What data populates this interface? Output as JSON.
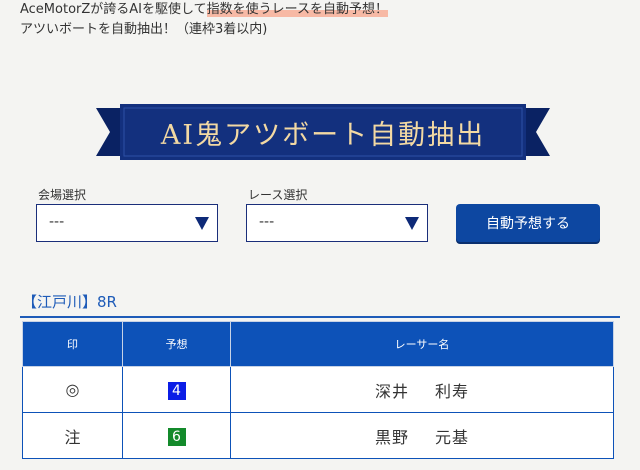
{
  "intro": {
    "line1_pre": "AceMotorZが誇るAIを駆使して",
    "line1_hl": "指数を使うレースを自動予想！",
    "line2": "アツいボートを自動抽出！（連枠3着以内)"
  },
  "banner": {
    "title": "AI鬼アツボート自動抽出"
  },
  "form": {
    "venue_label": "会場選択",
    "venue_value": "---",
    "race_label": "レース選択",
    "race_value": "---",
    "submit_label": "自動予想する"
  },
  "result": {
    "venue_title": "【江戸川】8R",
    "headers": [
      "印",
      "予想",
      "レーサー名"
    ],
    "rows": [
      {
        "mark": "◎",
        "boat": "4",
        "boat_color": "#0b1de6",
        "last": "深井",
        "first": "利寿"
      },
      {
        "mark": "注",
        "boat": "6",
        "boat_color": "#138a2b",
        "last": "黒野",
        "first": "元基"
      }
    ]
  },
  "colors": {
    "accent": "#0d52b8",
    "banner": "#13307e",
    "banner_text": "#f3d9a3",
    "highlight": "#f7b9a5"
  }
}
